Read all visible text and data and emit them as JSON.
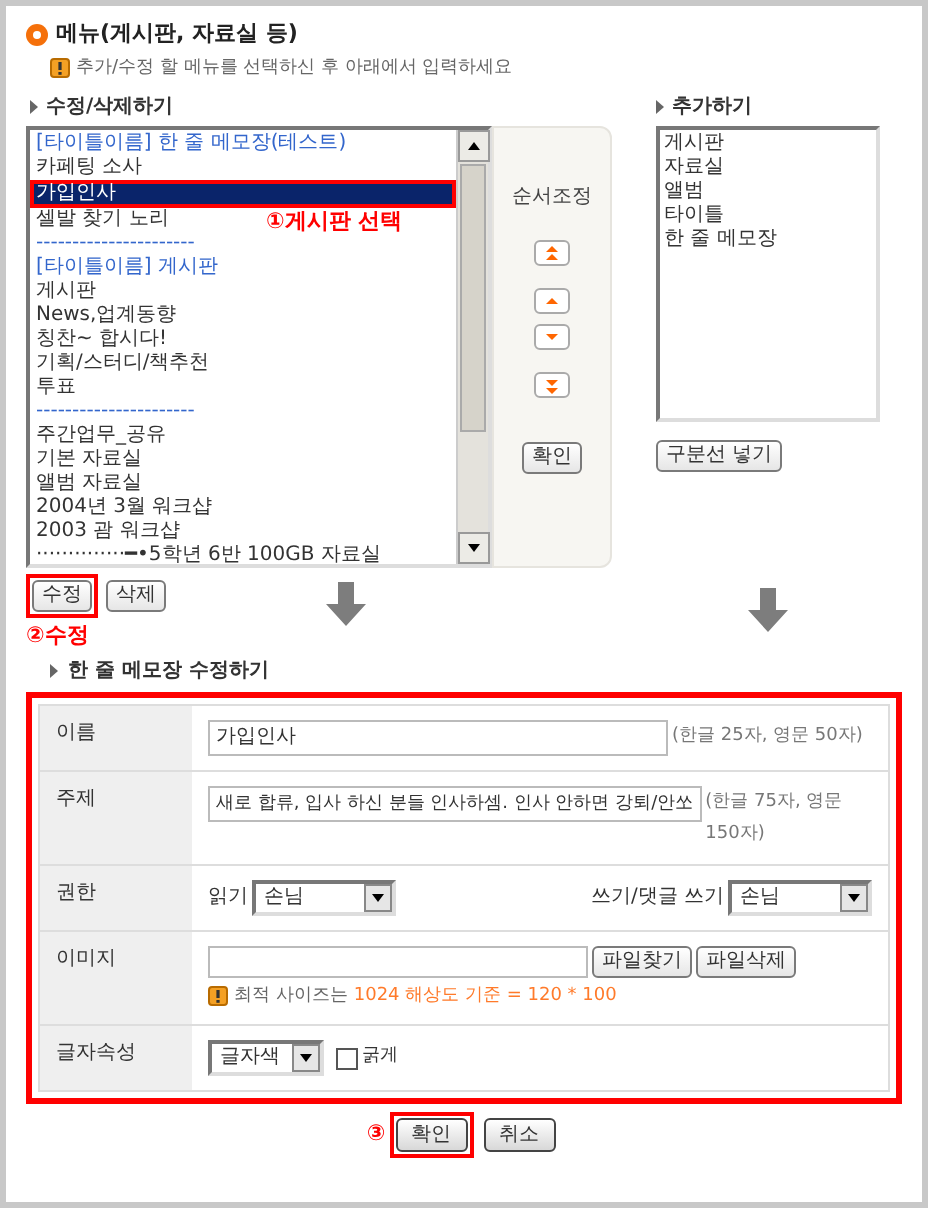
{
  "title": "메뉴(게시판, 자료실 등)",
  "hint": "추가/수정 할 메뉴를 선택하신 후 아래에서 입력하세요",
  "edit_section": {
    "heading": "수정/삭제하기",
    "annotation": "①게시판 선택",
    "items": [
      {
        "text": "[타이틀이름] 한 줄 메모장(테스트)",
        "kind": "title",
        "selected": false
      },
      {
        "text": "카페팅 소사",
        "kind": "item",
        "selected": false
      },
      {
        "text": "가입인사",
        "kind": "item",
        "selected": true
      },
      {
        "text": "셀발 찾기 노리",
        "kind": "item",
        "selected": false
      },
      {
        "text": "----------------------",
        "kind": "divider",
        "selected": false
      },
      {
        "text": "[타이틀이름] 게시판",
        "kind": "title",
        "selected": false
      },
      {
        "text": "게시판",
        "kind": "item",
        "selected": false
      },
      {
        "text": "News,업계동향",
        "kind": "item",
        "selected": false
      },
      {
        "text": "칭찬~ 합시다!",
        "kind": "item",
        "selected": false
      },
      {
        "text": "기획/스터디/책추천",
        "kind": "item",
        "selected": false
      },
      {
        "text": "투표",
        "kind": "item",
        "selected": false
      },
      {
        "text": "----------------------",
        "kind": "divider",
        "selected": false
      },
      {
        "text": "주간업무_공유",
        "kind": "item",
        "selected": false
      },
      {
        "text": "기본 자료실",
        "kind": "item",
        "selected": false
      },
      {
        "text": "앨범 자료실",
        "kind": "item",
        "selected": false
      },
      {
        "text": "2004년 3월 워크샵",
        "kind": "item",
        "selected": false
      },
      {
        "text": "2003 괌 워크샵",
        "kind": "item",
        "selected": false
      },
      {
        "text": "··············━•5학년 6반 100GB 자료실",
        "kind": "item",
        "selected": false
      }
    ]
  },
  "order_panel": {
    "label": "순서조정",
    "confirm": "확인"
  },
  "add_section": {
    "heading": "추가하기",
    "items": [
      "게시판",
      "자료실",
      "앨범",
      "타이틀",
      "한 줄 메모장"
    ],
    "button": "구분선 넣기"
  },
  "actions": {
    "buttons": [
      {
        "label": "수정",
        "highlighted": true
      },
      {
        "label": "삭제",
        "highlighted": false
      }
    ],
    "annotation": "②수정"
  },
  "form": {
    "heading": "한 줄 메모장 수정하기",
    "rows": [
      {
        "kind": "text",
        "label": "이름",
        "value": "가입인사",
        "note": "(한글 25자, 영문 50자)"
      },
      {
        "kind": "text",
        "label": "주제",
        "value": "새로 합류, 입사 하신 분들 인사하셈. 인사 안하면 강퇴/안쏘",
        "note": "(한글 75자, 영문 150자)"
      },
      {
        "kind": "permission",
        "label": "권한",
        "read_label": "읽기",
        "read_value": "손님",
        "write_label": "쓰기/댓글 쓰기",
        "write_value": "손님"
      },
      {
        "kind": "image",
        "label": "이미지",
        "find_button": "파일찾기",
        "delete_button": "파일삭제",
        "tip": "최적 사이즈는",
        "tip_highlight": "1024 해상도 기준 = 120 * 100"
      },
      {
        "kind": "font",
        "label": "글자속성",
        "color_value": "글자색",
        "bold_label": "굵게",
        "bold_checked": false
      }
    ]
  },
  "footer": {
    "marker": "③",
    "buttons": [
      {
        "label": "확인",
        "highlighted": true
      },
      {
        "label": "취소",
        "highlighted": false
      }
    ]
  }
}
